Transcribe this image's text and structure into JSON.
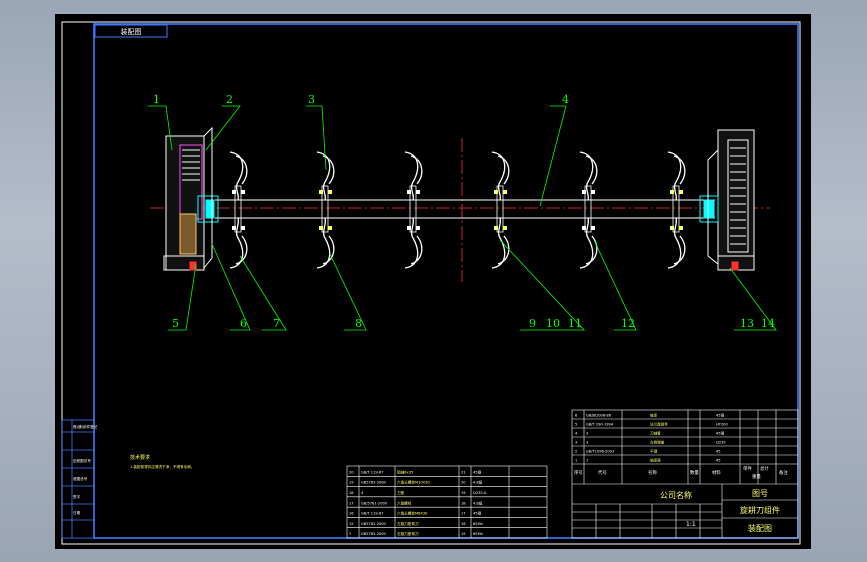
{
  "title_tab": "装配图",
  "balloons": [
    "1",
    "2",
    "3",
    "4",
    "5",
    "6",
    "7",
    "8",
    "9",
    "10",
    "11",
    "12",
    "13",
    "14"
  ],
  "tech_requirements": {
    "heading": "技术要求",
    "line1": "1.装配前零件应清洗干净，不得有毛刺。"
  },
  "bom_left": [
    [
      "20",
      "GB/T 119-87",
      "销轴8x35",
      "21",
      "45钢"
    ],
    [
      "19",
      "GB5783-2000",
      "六角头螺栓M10X30",
      "20",
      "4.8级"
    ],
    [
      "18",
      "4",
      "刀座",
      "19",
      "Q235-A"
    ],
    [
      "17",
      "GB/5781-2000",
      "六角螺栓",
      "18",
      "4.8级"
    ],
    [
      "16",
      "GB/T 119-87",
      "六角头螺栓M8X30",
      "17",
      "45钢"
    ],
    [
      "15",
      "GB5782-2000",
      "左旋刀座弯刀",
      "16",
      "65Mn"
    ],
    [
      "7",
      "GB5783-2000",
      "右旋刀座弯刀",
      "15",
      "65Mn"
    ]
  ],
  "bom_right": [
    [
      "6",
      "GB/JB1008-86",
      "轴承",
      "",
      "45钢"
    ],
    [
      "5",
      "GB/T 290-1994",
      "法兰盘组件",
      "",
      "HT200"
    ],
    [
      "4",
      "3",
      "刀轴管",
      "",
      "45钢"
    ],
    [
      "3",
      "3",
      "左侧端盖",
      "",
      "Q235"
    ],
    [
      "2",
      "GB/T1096-2003",
      "平键",
      "",
      "45"
    ],
    [
      "1",
      "1",
      "轴承座",
      "",
      "45"
    ]
  ],
  "bom_header": {
    "col1": "序号",
    "col2": "代号",
    "col3": "名称",
    "col4": "数量",
    "col5": "材料",
    "col6": "单件",
    "col7": "总计",
    "col8": "备注",
    "col9": "重量"
  },
  "title_block": {
    "company": "公司名称",
    "drawing_no_label": "图号",
    "part_name": "旋耕刀组件",
    "drawing_type": "装配图",
    "scale": "1:1"
  },
  "side_stamps": [
    "借(通)用件登记",
    "旧底图总号",
    "底图总号",
    "签字",
    "日期"
  ]
}
